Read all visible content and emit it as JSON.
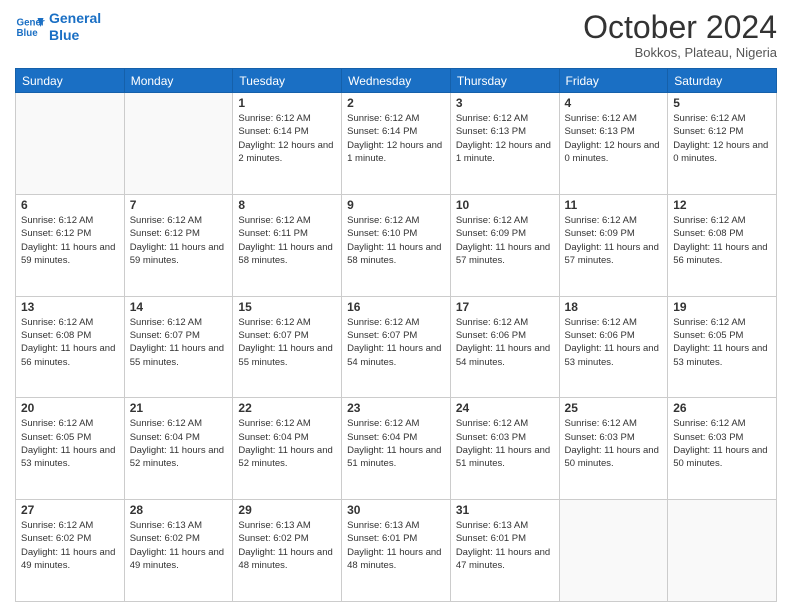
{
  "header": {
    "logo_line1": "General",
    "logo_line2": "Blue",
    "month": "October 2024",
    "location": "Bokkos, Plateau, Nigeria"
  },
  "weekdays": [
    "Sunday",
    "Monday",
    "Tuesday",
    "Wednesday",
    "Thursday",
    "Friday",
    "Saturday"
  ],
  "weeks": [
    [
      {
        "day": "",
        "info": ""
      },
      {
        "day": "",
        "info": ""
      },
      {
        "day": "1",
        "info": "Sunrise: 6:12 AM\nSunset: 6:14 PM\nDaylight: 12 hours and 2 minutes."
      },
      {
        "day": "2",
        "info": "Sunrise: 6:12 AM\nSunset: 6:14 PM\nDaylight: 12 hours and 1 minute."
      },
      {
        "day": "3",
        "info": "Sunrise: 6:12 AM\nSunset: 6:13 PM\nDaylight: 12 hours and 1 minute."
      },
      {
        "day": "4",
        "info": "Sunrise: 6:12 AM\nSunset: 6:13 PM\nDaylight: 12 hours and 0 minutes."
      },
      {
        "day": "5",
        "info": "Sunrise: 6:12 AM\nSunset: 6:12 PM\nDaylight: 12 hours and 0 minutes."
      }
    ],
    [
      {
        "day": "6",
        "info": "Sunrise: 6:12 AM\nSunset: 6:12 PM\nDaylight: 11 hours and 59 minutes."
      },
      {
        "day": "7",
        "info": "Sunrise: 6:12 AM\nSunset: 6:12 PM\nDaylight: 11 hours and 59 minutes."
      },
      {
        "day": "8",
        "info": "Sunrise: 6:12 AM\nSunset: 6:11 PM\nDaylight: 11 hours and 58 minutes."
      },
      {
        "day": "9",
        "info": "Sunrise: 6:12 AM\nSunset: 6:10 PM\nDaylight: 11 hours and 58 minutes."
      },
      {
        "day": "10",
        "info": "Sunrise: 6:12 AM\nSunset: 6:09 PM\nDaylight: 11 hours and 57 minutes."
      },
      {
        "day": "11",
        "info": "Sunrise: 6:12 AM\nSunset: 6:09 PM\nDaylight: 11 hours and 57 minutes."
      },
      {
        "day": "12",
        "info": "Sunrise: 6:12 AM\nSunset: 6:08 PM\nDaylight: 11 hours and 56 minutes."
      }
    ],
    [
      {
        "day": "13",
        "info": "Sunrise: 6:12 AM\nSunset: 6:08 PM\nDaylight: 11 hours and 56 minutes."
      },
      {
        "day": "14",
        "info": "Sunrise: 6:12 AM\nSunset: 6:07 PM\nDaylight: 11 hours and 55 minutes."
      },
      {
        "day": "15",
        "info": "Sunrise: 6:12 AM\nSunset: 6:07 PM\nDaylight: 11 hours and 55 minutes."
      },
      {
        "day": "16",
        "info": "Sunrise: 6:12 AM\nSunset: 6:07 PM\nDaylight: 11 hours and 54 minutes."
      },
      {
        "day": "17",
        "info": "Sunrise: 6:12 AM\nSunset: 6:06 PM\nDaylight: 11 hours and 54 minutes."
      },
      {
        "day": "18",
        "info": "Sunrise: 6:12 AM\nSunset: 6:06 PM\nDaylight: 11 hours and 53 minutes."
      },
      {
        "day": "19",
        "info": "Sunrise: 6:12 AM\nSunset: 6:05 PM\nDaylight: 11 hours and 53 minutes."
      }
    ],
    [
      {
        "day": "20",
        "info": "Sunrise: 6:12 AM\nSunset: 6:05 PM\nDaylight: 11 hours and 53 minutes."
      },
      {
        "day": "21",
        "info": "Sunrise: 6:12 AM\nSunset: 6:04 PM\nDaylight: 11 hours and 52 minutes."
      },
      {
        "day": "22",
        "info": "Sunrise: 6:12 AM\nSunset: 6:04 PM\nDaylight: 11 hours and 52 minutes."
      },
      {
        "day": "23",
        "info": "Sunrise: 6:12 AM\nSunset: 6:04 PM\nDaylight: 11 hours and 51 minutes."
      },
      {
        "day": "24",
        "info": "Sunrise: 6:12 AM\nSunset: 6:03 PM\nDaylight: 11 hours and 51 minutes."
      },
      {
        "day": "25",
        "info": "Sunrise: 6:12 AM\nSunset: 6:03 PM\nDaylight: 11 hours and 50 minutes."
      },
      {
        "day": "26",
        "info": "Sunrise: 6:12 AM\nSunset: 6:03 PM\nDaylight: 11 hours and 50 minutes."
      }
    ],
    [
      {
        "day": "27",
        "info": "Sunrise: 6:12 AM\nSunset: 6:02 PM\nDaylight: 11 hours and 49 minutes."
      },
      {
        "day": "28",
        "info": "Sunrise: 6:13 AM\nSunset: 6:02 PM\nDaylight: 11 hours and 49 minutes."
      },
      {
        "day": "29",
        "info": "Sunrise: 6:13 AM\nSunset: 6:02 PM\nDaylight: 11 hours and 48 minutes."
      },
      {
        "day": "30",
        "info": "Sunrise: 6:13 AM\nSunset: 6:01 PM\nDaylight: 11 hours and 48 minutes."
      },
      {
        "day": "31",
        "info": "Sunrise: 6:13 AM\nSunset: 6:01 PM\nDaylight: 11 hours and 47 minutes."
      },
      {
        "day": "",
        "info": ""
      },
      {
        "day": "",
        "info": ""
      }
    ]
  ]
}
